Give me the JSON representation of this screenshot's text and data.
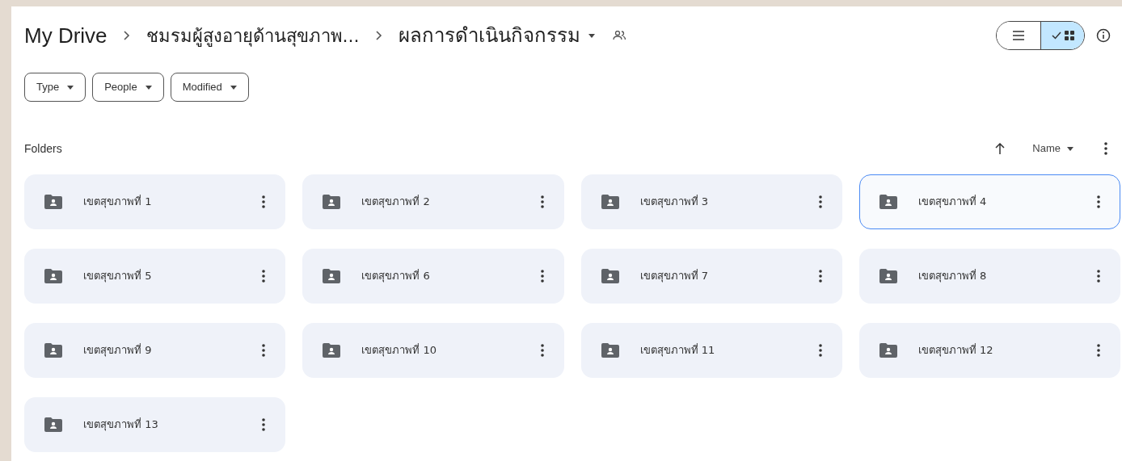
{
  "breadcrumb": [
    {
      "label": "My Drive"
    },
    {
      "label": "ชมรมผู้สูงอายุด้านสุขภาพ..."
    },
    {
      "label": "ผลการดำเนินกิจกรรม"
    }
  ],
  "view_toggle": [
    {
      "kind": "list",
      "selected": false
    },
    {
      "kind": "grid",
      "selected": true
    }
  ],
  "filters": [
    {
      "label": "Type"
    },
    {
      "label": "People"
    },
    {
      "label": "Modified"
    }
  ],
  "section_title": "Folders",
  "sort": {
    "label": "Name"
  },
  "folders": [
    {
      "name": "เขตสุขภาพที่ 1",
      "selected": false
    },
    {
      "name": "เขตสุขภาพที่ 2",
      "selected": false
    },
    {
      "name": "เขตสุขภาพที่ 3",
      "selected": false
    },
    {
      "name": "เขตสุขภาพที่ 4",
      "selected": true
    },
    {
      "name": "เขตสุขภาพที่ 5",
      "selected": false
    },
    {
      "name": "เขตสุขภาพที่ 6",
      "selected": false
    },
    {
      "name": "เขตสุขภาพที่ 7",
      "selected": false
    },
    {
      "name": "เขตสุขภาพที่ 8",
      "selected": false
    },
    {
      "name": "เขตสุขภาพที่ 9",
      "selected": false
    },
    {
      "name": "เขตสุขภาพที่ 10",
      "selected": false
    },
    {
      "name": "เขตสุขภาพที่ 11",
      "selected": false
    },
    {
      "name": "เขตสุขภาพที่ 12",
      "selected": false
    },
    {
      "name": "เขตสุขภาพที่ 13",
      "selected": false
    }
  ]
}
